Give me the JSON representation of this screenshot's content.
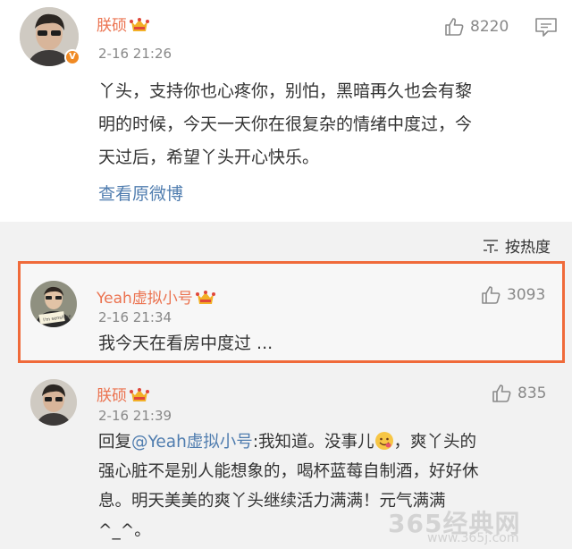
{
  "post": {
    "author": "朕硕",
    "time": "2-16 21:26",
    "likes": "8220",
    "text_line1": "丫头，支持你也心疼你，别怕，黑暗再久也会有黎",
    "text_line2": "明的时候，今天一天你在很复杂的情绪中度过，今",
    "text_line3": "天过后，希望丫头开心快乐。",
    "view_original": "查看原微博"
  },
  "sort": {
    "label": "按热度"
  },
  "comment1": {
    "author": "Yeah虚拟小号",
    "time": "2-16 21:34",
    "likes": "3093",
    "text": "我今天在看房中度过 ..."
  },
  "comment2": {
    "author": "朕硕",
    "time": "2-16 21:39",
    "likes": "835",
    "reply_prefix": "回复",
    "mention": "@Yeah虚拟小号",
    "text_line1_tail": ":我知道。没事儿",
    "text_line1_end": "，爽丫头的",
    "text_line2": "强心脏不是别人能想象的，喝杯蓝莓自制酒，好好休",
    "text_line3": "息。明天美美的爽丫头继续活力满满！元气满满",
    "text_line4": "^_^。"
  },
  "watermark": {
    "line1": "365经典网",
    "line2": "www.365j.com"
  },
  "colors": {
    "name": "#eb7350",
    "link": "#507daf",
    "highlight_border": "#f06a3a"
  },
  "icons": [
    "thumbs-up-icon",
    "comment-icon",
    "crown-icon",
    "verified-icon",
    "sort-icon",
    "emoji-icon"
  ]
}
